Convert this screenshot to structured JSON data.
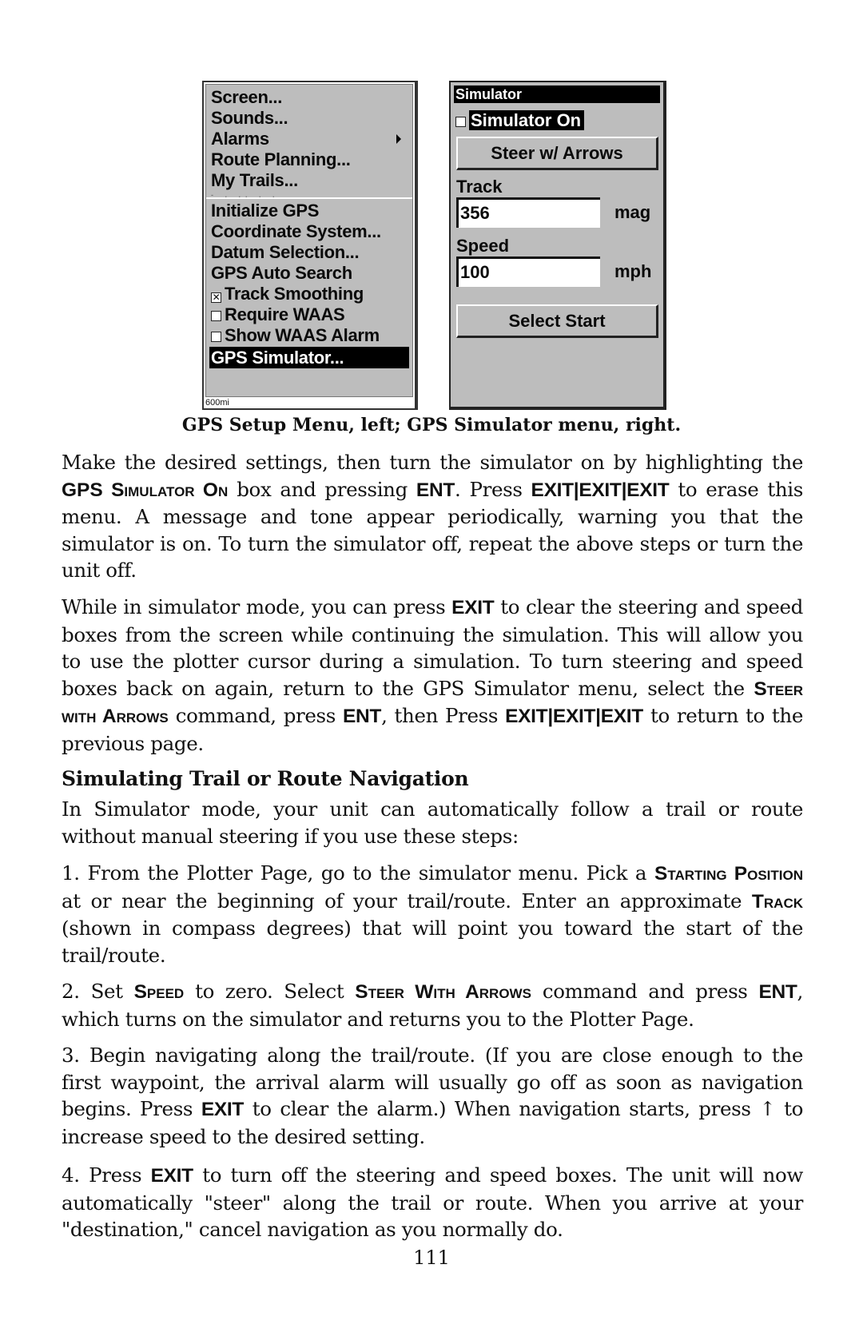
{
  "setup_menu": {
    "items_top": [
      {
        "label": "Screen...",
        "submenu": false
      },
      {
        "label": "Sounds...",
        "submenu": false
      },
      {
        "label": "Alarms",
        "submenu": true
      },
      {
        "label": "Route Planning...",
        "submenu": false
      },
      {
        "label": "My Trails..."
      }
    ],
    "items_gps": [
      {
        "label": "Initialize GPS"
      },
      {
        "label": "Coordinate System..."
      },
      {
        "label": "Datum Selection..."
      },
      {
        "label": "GPS Auto Search"
      },
      {
        "label": "Track Smoothing",
        "checkbox": true,
        "checked": true
      },
      {
        "label": "Require WAAS",
        "checkbox": true,
        "checked": false
      },
      {
        "label": "Show WAAS Alarm",
        "checkbox": true,
        "checked": false
      }
    ],
    "selected_item": "GPS Simulator...",
    "scale_text": "600mi"
  },
  "simulator_menu": {
    "title": "Simulator",
    "simulator_on_label": "Simulator On",
    "simulator_on_checked": false,
    "steer_button": "Steer w/ Arrows",
    "track_label": "Track",
    "track_value": "356",
    "track_unit": "mag",
    "speed_label": "Speed",
    "speed_value": "100",
    "speed_unit": "mph",
    "select_start_button": "Select Start"
  },
  "caption": "GPS Setup Menu, left; GPS Simulator menu, right.",
  "paragraph1": {
    "t1": "Make the desired settings, then turn the simulator on by highlighting the ",
    "k1": "GPS Simulator On",
    "t2": " box and pressing ",
    "k2": "ENT",
    "t3": ". Press ",
    "k3": "EXIT|EXIT|EXIT",
    "t4": " to erase this menu. A message and tone appear periodically, warning you that the simulator is on. To turn the simulator off, repeat the above steps or turn the unit off."
  },
  "paragraph2": {
    "t1": "While in simulator mode, you can press ",
    "k1": "EXIT",
    "t2": " to clear the steering and speed boxes from the screen while continuing the simulation. This will allow you to use the plotter cursor during a simulation. To turn steer­ing and speed boxes back on again, return to the GPS Simulator menu, select the ",
    "k2": "Steer with Arrows",
    "t3": " command, press ",
    "k3": "ENT",
    "t4": ", then Press ",
    "k4": "EXIT|EXIT|EXIT",
    "t5": " to return to the previous page."
  },
  "heading": "Simulating Trail or Route Navigation",
  "intro": "In Simulator mode, your unit can automatically follow a trail or route without manual steering if you use these steps:",
  "step1": {
    "t1": "1. From the Plotter Page, go to the simulator menu. Pick a ",
    "k1": "Starting Position",
    "t2": " at or near the beginning of your trail/route. Enter an approxi­mate ",
    "k2": "Track",
    "t3": " (shown in compass degrees) that will point you toward the start of the trail/route."
  },
  "step2": {
    "t1": "2. Set ",
    "k1": "Speed",
    "t2": " to zero. Select ",
    "k2": "Steer With Arrows",
    "t3": " command and press ",
    "k3": "ENT",
    "t4": ", which turns on the simulator and returns you to the Plotter Page."
  },
  "step3": {
    "t1": "3. Begin navigating along the trail/route. (If you are close enough to the first waypoint, the arrival alarm will usually go off as soon as naviga­tion begins. Press ",
    "k1": "EXIT",
    "t2": " to clear the alarm.) When navigation starts, press ",
    "arrow": "↑",
    "t3": " to increase speed to the desired setting."
  },
  "step4": {
    "t1": "4. Press ",
    "k1": "EXIT",
    "t2": " to turn off the steering and speed boxes. The unit will now automatically \"steer\" along the trail or route. When you arrive at your \"destination,\" cancel navigation as you normally do."
  },
  "page_number": "111"
}
